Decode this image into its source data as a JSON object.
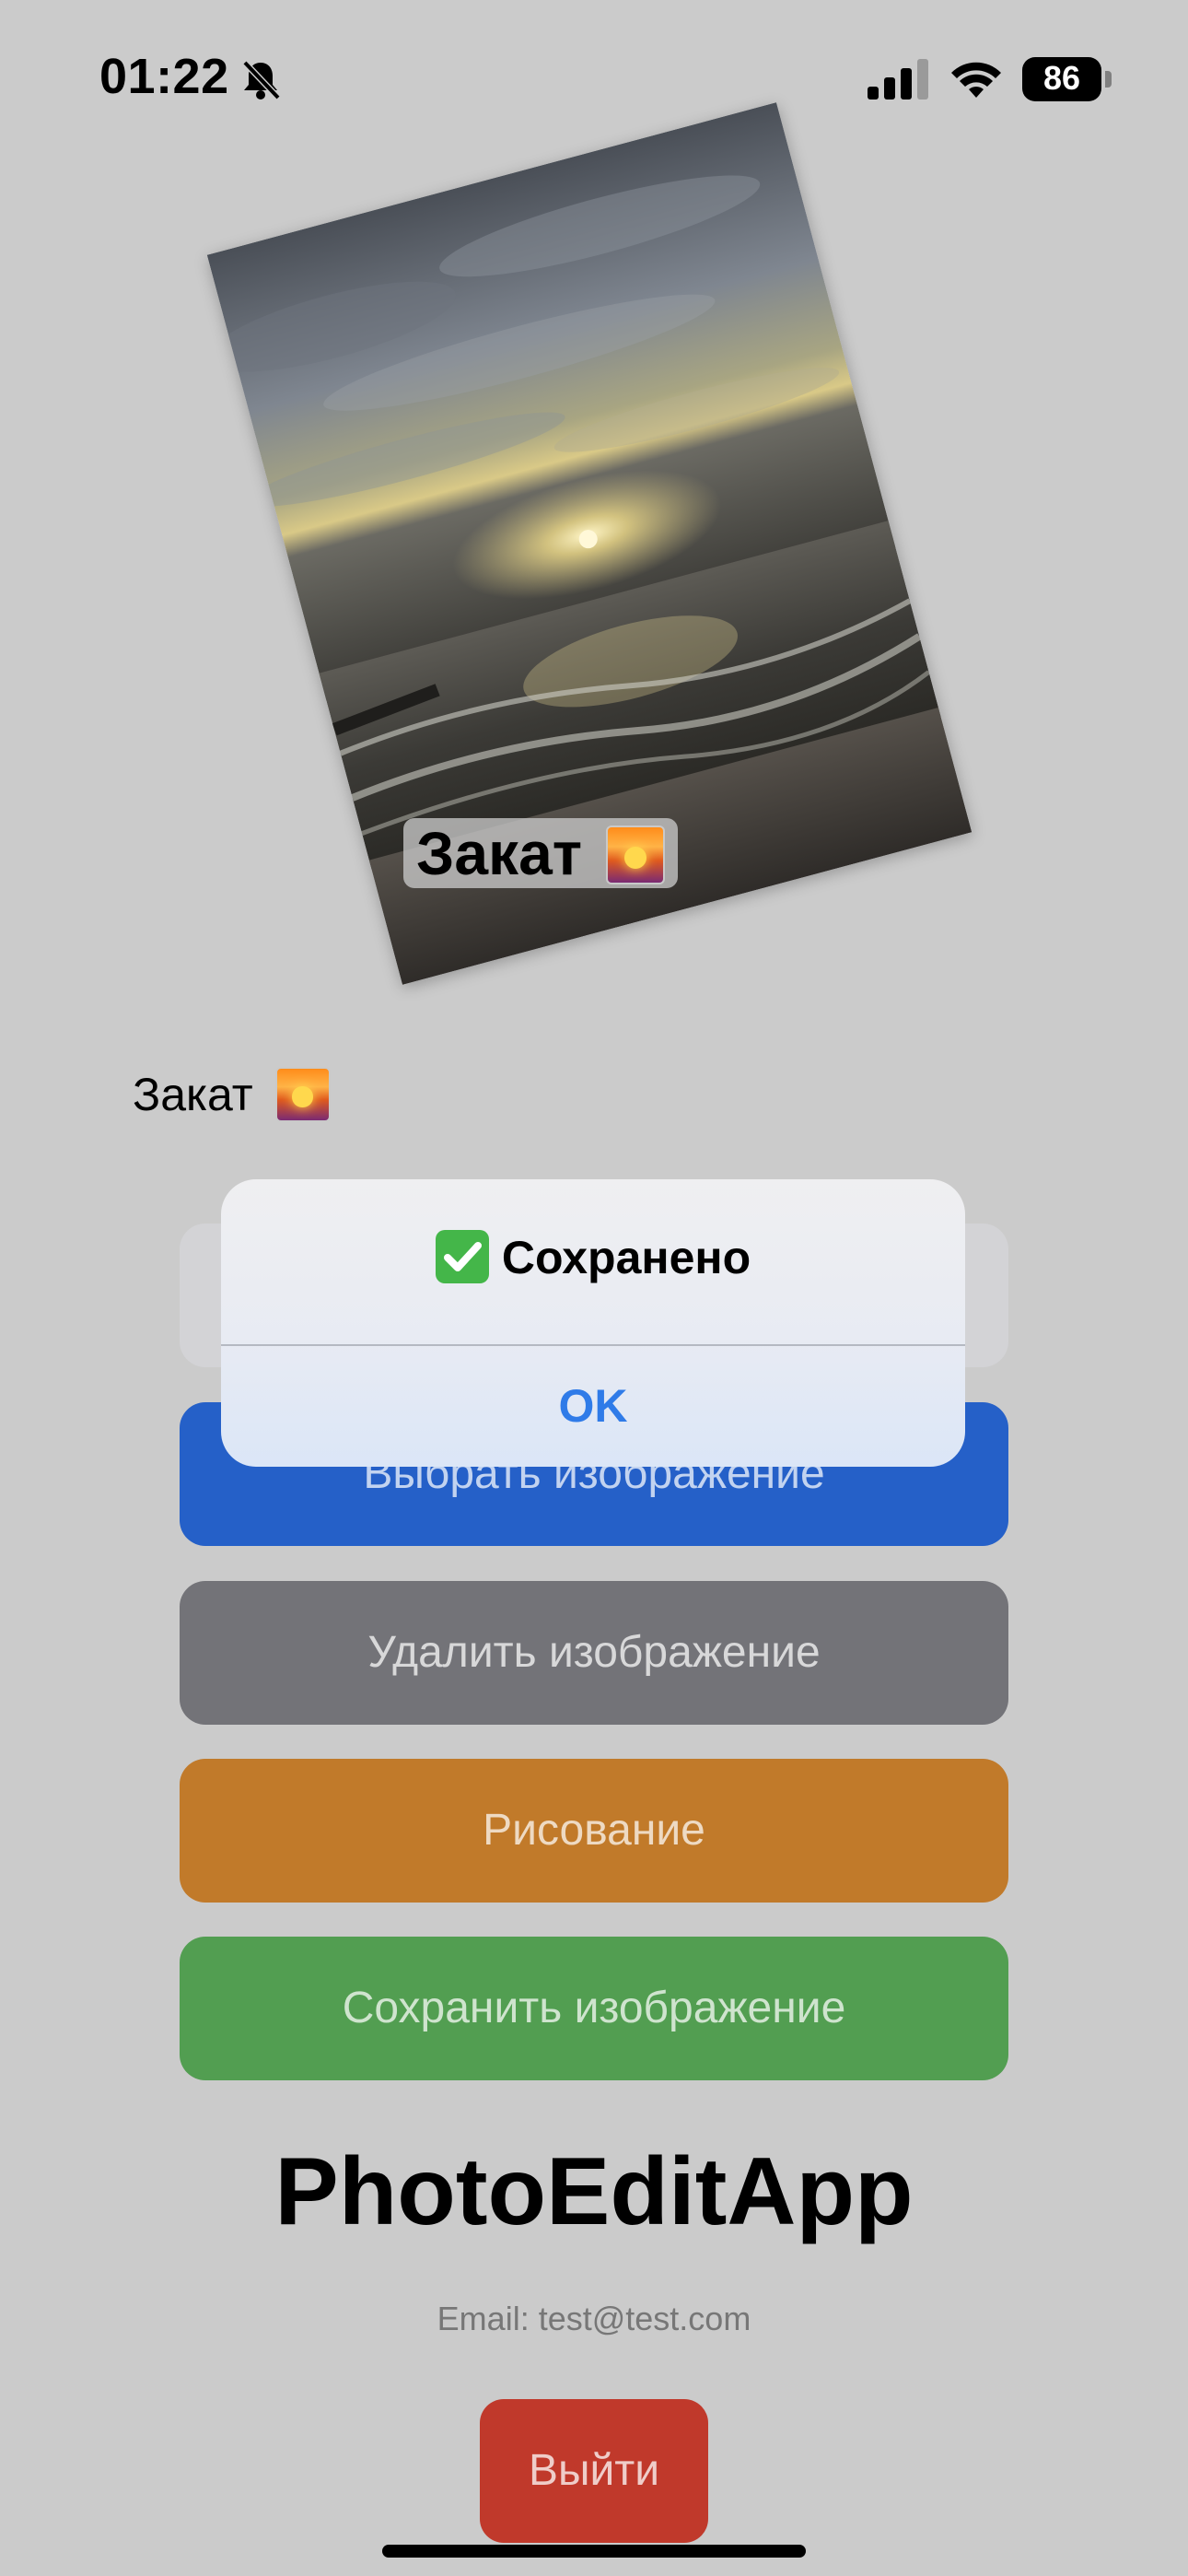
{
  "status_bar": {
    "time": "01:22",
    "battery": "86",
    "icons": [
      "bell-slash-icon",
      "cellular-signal-icon",
      "wifi-icon",
      "battery-icon"
    ]
  },
  "photo": {
    "caption_text": "Закат",
    "caption_emoji": "sunset-emoji-icon"
  },
  "label": {
    "text": "Закат"
  },
  "buttons": {
    "choose": "Выбрать изображение",
    "delete": "Удалить изображение",
    "draw": "Рисование",
    "save": "Сохранить изображение"
  },
  "app": {
    "title": "PhotoEditApp",
    "email": "Email: test@test.com",
    "logout": "Выйти"
  },
  "alert": {
    "title": "Сохранено",
    "ok": "OK"
  },
  "colors": {
    "background": "#cbcbcb",
    "choose": "#2560c8",
    "delete": "#737378",
    "draw": "#c17a2a",
    "save": "#529e51",
    "logout": "#c0392b",
    "alert_button": "#2f7be8"
  }
}
